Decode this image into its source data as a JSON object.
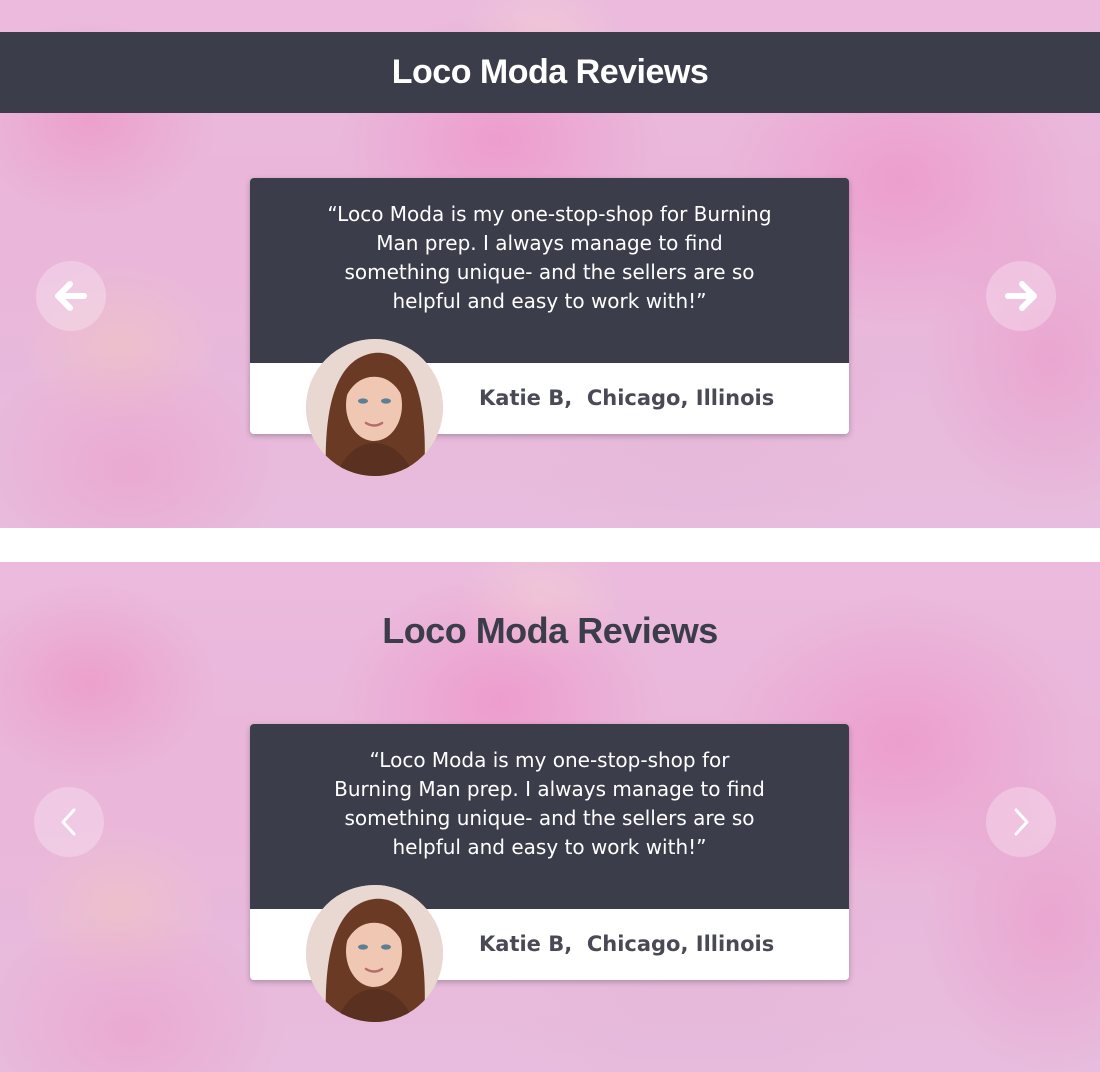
{
  "variants": [
    {
      "title": "Loco Moda Reviews",
      "review": {
        "quote_lines": [
          "“Loco Moda is my one-stop-shop for Burning",
          "Man prep.  I always manage to find",
          "something unique- and the sellers are so",
          "helpful and easy to work with!”"
        ],
        "author": "Katie B,  Chicago, Illinois"
      },
      "prev_icon": "arrow-left-icon",
      "next_icon": "arrow-right-icon"
    },
    {
      "title": "Loco Moda Reviews",
      "review": {
        "quote_lines": [
          "“Loco Moda is my one-stop-shop for",
          "Burning Man prep.  I always manage to find",
          "something unique- and the sellers are so",
          "helpful and easy to work with!”"
        ],
        "author": "Katie B,  Chicago, Illinois"
      },
      "prev_icon": "chevron-left-icon",
      "next_icon": "chevron-right-icon"
    }
  ],
  "colors": {
    "dark_slate": "#3c3d4a",
    "card_white": "#ffffff",
    "background_pink": "#e6acd4"
  }
}
